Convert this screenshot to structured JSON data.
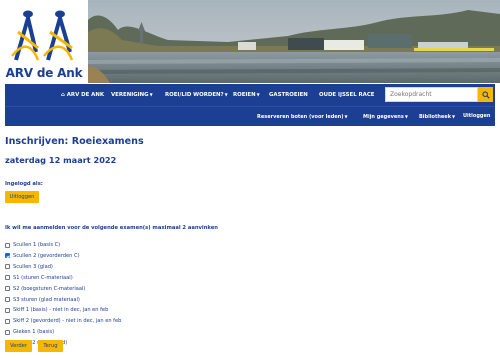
{
  "site": {
    "name": "ARV de Ank",
    "colors": {
      "navy": "#1c3e93",
      "yellow": "#f5b700"
    }
  },
  "nav": {
    "primary": [
      {
        "label": "ARV DE ANK",
        "icon": "home-icon",
        "caret": false
      },
      {
        "label": "VERENIGING",
        "caret": true
      },
      {
        "label": "ROEI/LID WORDEN?",
        "caret": true
      },
      {
        "label": "ROEIEN",
        "caret": true
      },
      {
        "label": "GASTROEIEN",
        "caret": false
      },
      {
        "label": "OUDE IJSSEL RACE",
        "caret": false
      }
    ],
    "secondary": [
      {
        "label": "Reserveren boten (voor leden)",
        "caret": true
      },
      {
        "label": "Mijn gegevens",
        "caret": true
      },
      {
        "label": "Bibliotheek",
        "caret": true
      },
      {
        "label": "Uitloggen",
        "caret": false
      }
    ],
    "search": {
      "placeholder": "Zoekopdracht",
      "icon": "search-icon"
    }
  },
  "page": {
    "title": "Inschrijven: Roeiexamens",
    "date": "zaterdag 12 maart 2022",
    "logged_in_label": "Ingelogd als:",
    "logout_button": "Uitloggen",
    "instruction": "Ik wil me aanmelden voor de volgende examen(s) maximaal 2 aanvinken",
    "options": [
      {
        "label": "Scullen 1 (basis C)",
        "checked": false
      },
      {
        "label": "Scullen 2 (gevorderden C)",
        "checked": true
      },
      {
        "label": "Scullen 3 (glad)",
        "checked": false
      },
      {
        "label": "S1 (sturen C-materiaal)",
        "checked": false
      },
      {
        "label": "S2 (boegsturen C-materiaal)",
        "checked": false
      },
      {
        "label": "S3 sturen (glad materiaal)",
        "checked": false
      },
      {
        "label": "Skiff 1 (basis) - niet in dec, jan en feb",
        "checked": false
      },
      {
        "label": "Skiff 2 (gevorderd) - niet in dec, jan en feb",
        "checked": false
      },
      {
        "label": "Gieken 1 (basis)",
        "checked": false
      },
      {
        "label": "Gieken 2 (gevorderd)",
        "checked": false
      }
    ],
    "buttons": {
      "submit": "Verder",
      "back": "Terug"
    }
  }
}
